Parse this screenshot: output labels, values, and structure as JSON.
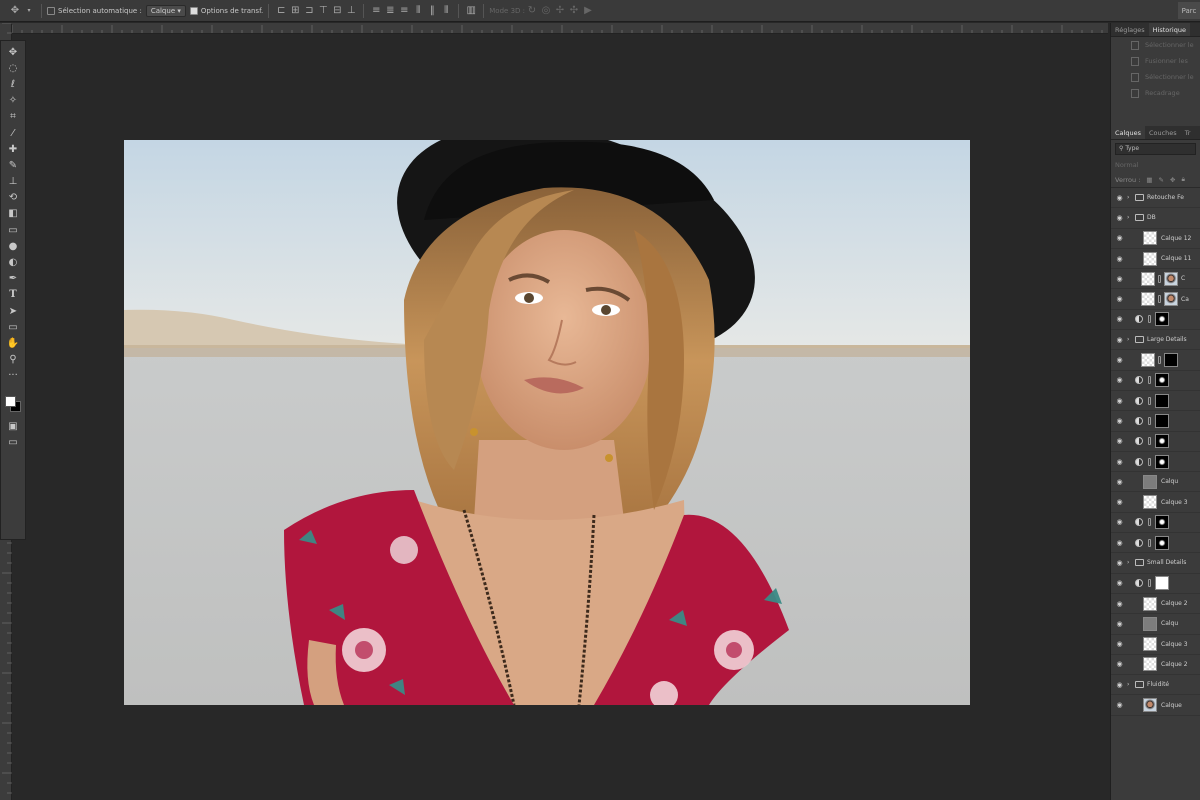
{
  "options_bar": {
    "auto_select_label": "Sélection automatique :",
    "auto_select_value": "Calque",
    "transform_label": "Options de transf.",
    "mode_3d_label": "Mode 3D :",
    "right_button": "Parc"
  },
  "tools": [
    "move-icon",
    "marquee-icon",
    "lasso-icon",
    "magic-wand-icon",
    "crop-icon",
    "eyedropper-icon",
    "healing-icon",
    "brush-icon",
    "clone-stamp-icon",
    "history-brush-icon",
    "eraser-icon",
    "gradient-icon",
    "blur-icon",
    "dodge-icon",
    "pen-icon",
    "type-icon",
    "path-select-icon",
    "shape-icon",
    "hand-icon",
    "zoom-icon",
    "more-icon"
  ],
  "swatches": {
    "foreground": "#ffffff",
    "background": "#000000"
  },
  "history_panel": {
    "tabs": [
      "Réglages",
      "Historique"
    ],
    "active_tab": "Historique",
    "items": [
      "Sélectionner le",
      "Fusionner les",
      "Sélectionner le",
      "Recadrage"
    ]
  },
  "layers_panel": {
    "tabs": [
      "Calques",
      "Couches",
      "Tr"
    ],
    "active_tab": "Calques",
    "filter_value": "Type",
    "blend_mode": "Normal",
    "lock_label": "Verrou :",
    "layers": [
      {
        "name": "Retouche Fe",
        "kind": "group"
      },
      {
        "name": "DB",
        "kind": "group"
      },
      {
        "name": "Calque 12",
        "kind": "layer",
        "thumb": "checker"
      },
      {
        "name": "Calque 11",
        "kind": "layer",
        "thumb": "checker"
      },
      {
        "name": "C",
        "kind": "masked",
        "thumb": "face"
      },
      {
        "name": "Ca",
        "kind": "masked",
        "thumb": "face"
      },
      {
        "name": "",
        "kind": "adjust",
        "thumb": "mask"
      },
      {
        "name": "Large Details",
        "kind": "group"
      },
      {
        "name": "",
        "kind": "masked",
        "thumb": "black"
      },
      {
        "name": "",
        "kind": "adjust",
        "thumb": "mask"
      },
      {
        "name": "",
        "kind": "adjust",
        "thumb": "black"
      },
      {
        "name": "",
        "kind": "adjust",
        "thumb": "black"
      },
      {
        "name": "",
        "kind": "adjust",
        "thumb": "mask"
      },
      {
        "name": "",
        "kind": "adjust",
        "thumb": "mask"
      },
      {
        "name": "Calqu",
        "kind": "layer",
        "thumb": "gray"
      },
      {
        "name": "Calque 3",
        "kind": "layer",
        "thumb": "checker"
      },
      {
        "name": "",
        "kind": "adjust",
        "thumb": "mask"
      },
      {
        "name": "",
        "kind": "adjust",
        "thumb": "mask"
      },
      {
        "name": "Small Details",
        "kind": "group"
      },
      {
        "name": "",
        "kind": "adjust",
        "thumb": "white"
      },
      {
        "name": "Calque 2",
        "kind": "layer",
        "thumb": "checker"
      },
      {
        "name": "Calqu",
        "kind": "layer",
        "thumb": "gray"
      },
      {
        "name": "Calque 3",
        "kind": "layer",
        "thumb": "checker"
      },
      {
        "name": "Calque 2",
        "kind": "layer",
        "thumb": "checker"
      },
      {
        "name": "Fluidité",
        "kind": "group"
      },
      {
        "name": "Calque",
        "kind": "layer",
        "thumb": "face"
      }
    ]
  },
  "colors": {
    "sky_top": "#c4d6e4",
    "sky_bottom": "#e6e8e6",
    "ground": "#c5c6c4",
    "dress": "#b1163d",
    "hat": "#141414",
    "hair": "#b98850",
    "skin": "#dba685"
  }
}
